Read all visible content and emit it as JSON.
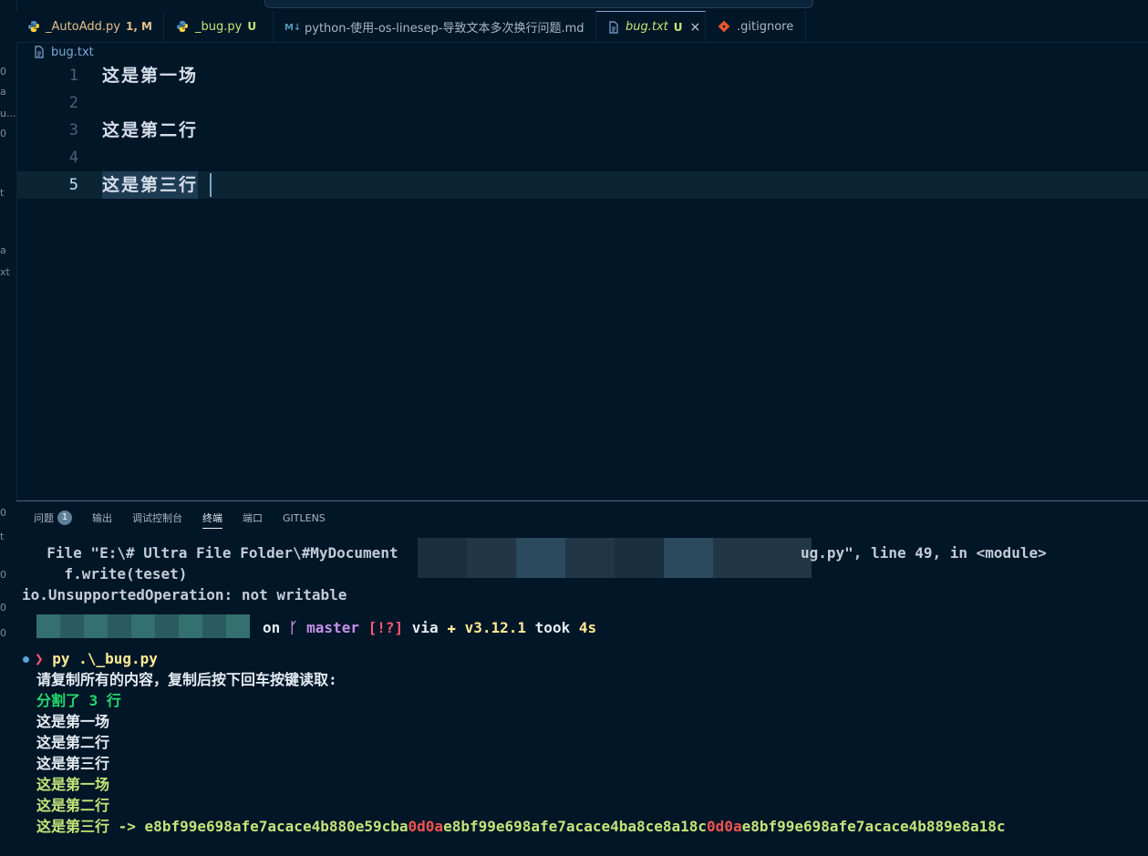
{
  "tabs": [
    {
      "label": "_AutoAdd.py",
      "status": "1, M",
      "icon": "python-icon",
      "label_color": "#e2c08d",
      "status_color": "#e2c08d",
      "italic": false,
      "active": false
    },
    {
      "label": "_bug.py",
      "status": "U",
      "icon": "python-icon",
      "label_color": "#c5e478",
      "status_color": "#c5e478",
      "italic": false,
      "active": false
    },
    {
      "label": "python-使用-os-linesep-导致文本多次换行问题.md",
      "status": "",
      "icon": "markdown-icon",
      "label_color": "#a9b7c6",
      "status_color": "",
      "italic": false,
      "active": false
    },
    {
      "label": "bug.txt",
      "status": "U",
      "icon": "file-icon",
      "label_color": "#c5e478",
      "status_color": "#c5e478",
      "italic": true,
      "active": true
    },
    {
      "label": ".gitignore",
      "status": "",
      "icon": "git-icon",
      "label_color": "#a9b7c6",
      "status_color": "",
      "italic": false,
      "active": false
    }
  ],
  "tab_close_glyph": "×",
  "breadcrumb": {
    "file": "bug.txt",
    "icon": "file-icon"
  },
  "editor": {
    "lines": [
      {
        "num": "1",
        "text": "这是第一场"
      },
      {
        "num": "2",
        "text": ""
      },
      {
        "num": "3",
        "text": "这是第二行"
      },
      {
        "num": "4",
        "text": ""
      },
      {
        "num": "5",
        "text": "这是第三行"
      }
    ],
    "current_line": 5
  },
  "panel": {
    "tabs": [
      "问题",
      "输出",
      "调试控制台",
      "终端",
      "端口",
      "GITLENS"
    ],
    "problems_count": "1",
    "active_tab": "终端"
  },
  "terminal": {
    "trace_file_prefix": "  File \"E:\\# Ultra File Folder\\#MyDocument",
    "trace_file_suffix": "ug.py\", line 49, in <module>",
    "trace_code": "    f.write(teset)",
    "error": "io.UnsupportedOperation: not writable",
    "prompt_on": "on",
    "branch_icon": "git-branch-icon",
    "branch": "master",
    "git_status": "[!?]",
    "via": "via",
    "python_icon": "python-icon",
    "py_version": "v3.12.1",
    "took": "took",
    "duration": "4s",
    "prompt_symbol": "❯",
    "command": "py .\\_bug.py",
    "out_prompt": "请复制所有的内容，复制后按下回车按键读取:",
    "out_split": "分割了 3 行",
    "out_plain": [
      "这是第一场",
      "这是第二行",
      "这是第三行"
    ],
    "out_green": [
      "这是第一场",
      "这是第二行"
    ],
    "last_label": "这是第三行",
    "arrow": " -> ",
    "hex_parts": [
      {
        "text": "e8bf99e698afe7acace4b880e59cba",
        "kind": "normal"
      },
      {
        "text": "0d0a",
        "kind": "crlf"
      },
      {
        "text": "e8bf99e698afe7acace4ba8ce8a18c",
        "kind": "normal"
      },
      {
        "text": "0d0a",
        "kind": "crlf"
      },
      {
        "text": "e8bf99e698afe7acace4b889e8a18c",
        "kind": "normal"
      }
    ]
  },
  "left_strip_marks": [
    "0",
    "a",
    "u...",
    "0",
    "t",
    "a",
    "xt",
    "0",
    "t",
    "0",
    "0",
    "0"
  ]
}
